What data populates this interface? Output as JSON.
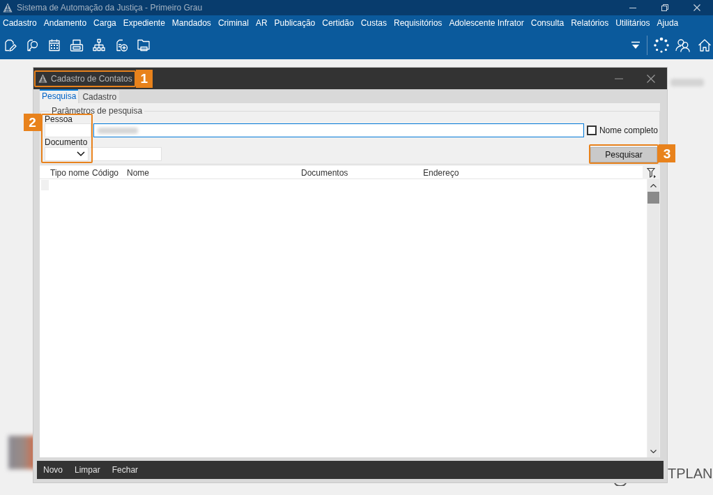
{
  "window": {
    "title": "Sistema de Automação da Justiça - Primeiro Grau"
  },
  "menu": [
    "Cadastro",
    "Andamento",
    "Carga",
    "Expediente",
    "Mandados",
    "Criminal",
    "AR",
    "Publicação",
    "Certidão",
    "Custas",
    "Requisitórios",
    "Adolescente Infrator",
    "Consulta",
    "Relatórios",
    "Utilitários",
    "Ajuda"
  ],
  "background": {
    "logo_text": "TPLAN"
  },
  "dialog": {
    "title": "Cadastro de Contatos",
    "title_callout": "1",
    "tabs": [
      {
        "label": "Pesquisa",
        "selected": true
      },
      {
        "label": "Cadastro",
        "selected": false
      }
    ],
    "search_parameters": {
      "legend": "Parâmetros de pesquisa",
      "callout": "2",
      "pessoa": {
        "label": "Pessoa",
        "focused": true
      },
      "nome_completo": {
        "label": "Nome completo",
        "checked": false
      },
      "documento": {
        "label": "Documento"
      },
      "search_button": {
        "label": "Pesquisar",
        "callout": "3"
      }
    },
    "table": {
      "columns": [
        "Tipo nome",
        "Código",
        "Nome",
        "Documentos",
        "Endereço"
      ]
    },
    "footer": [
      "Novo",
      "Limpar",
      "Fechar"
    ]
  }
}
